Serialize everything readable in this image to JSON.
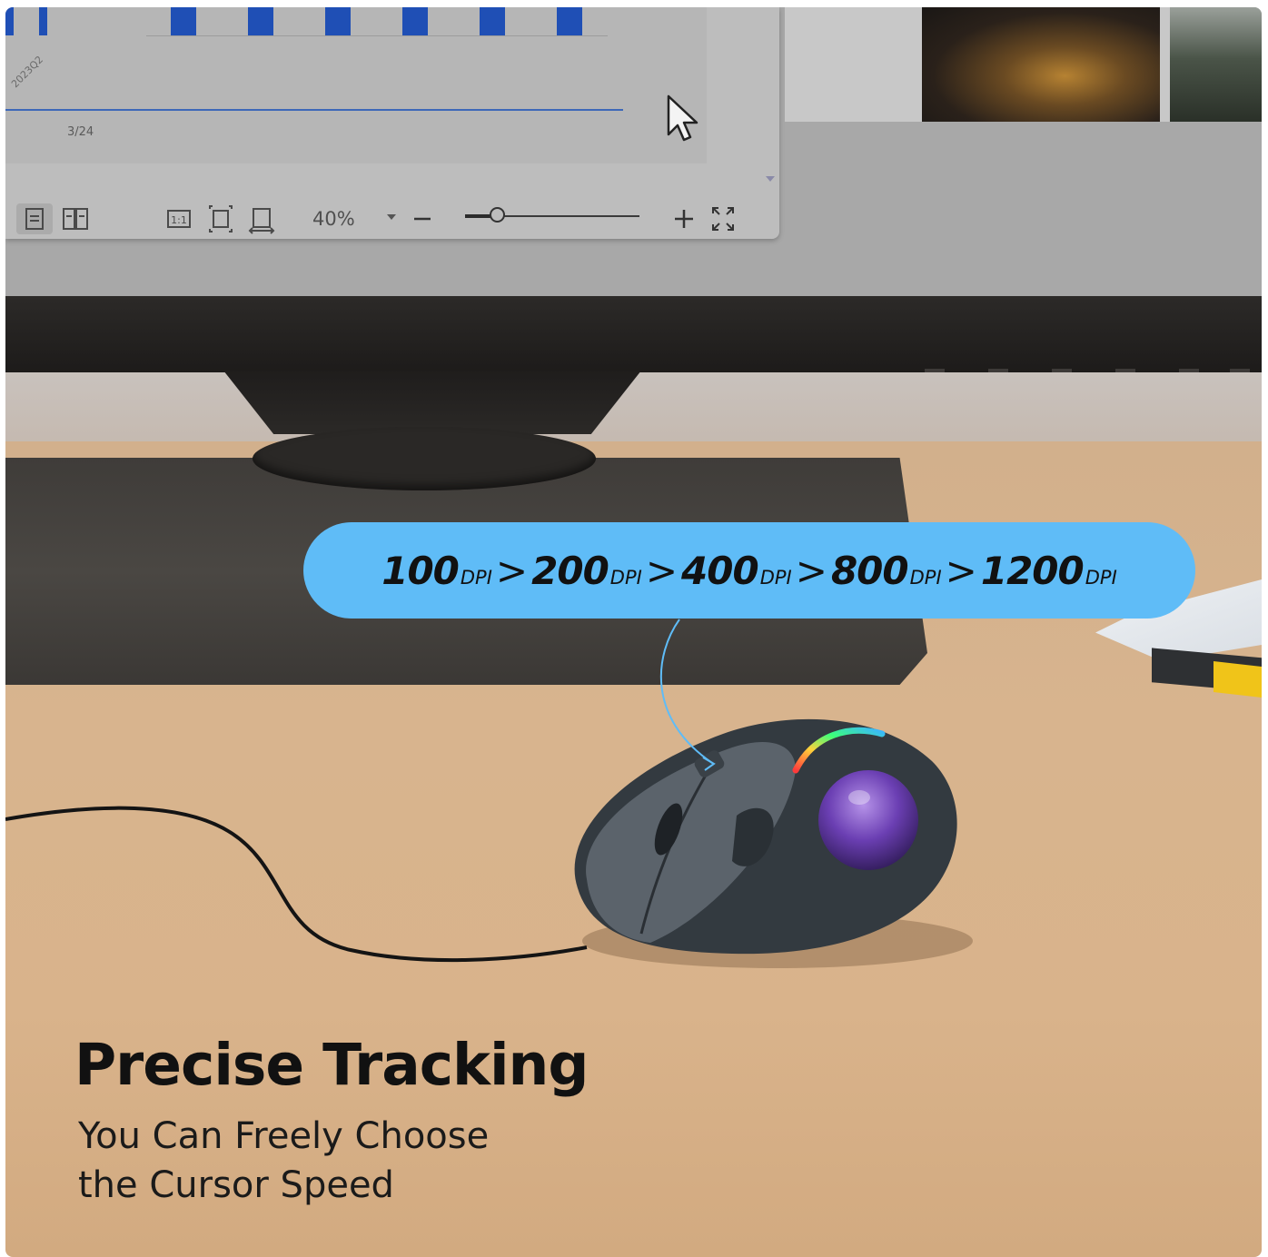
{
  "screen": {
    "bar_tick_labels": [
      "2023Q2"
    ],
    "page_indicator": "3/24",
    "toolbar": {
      "zoom_level": "40%",
      "zoom_slider_fraction": 0.18,
      "icons": [
        "single-page-icon",
        "two-page-icon",
        "actual-size-icon",
        "fit-page-icon",
        "fit-width-icon",
        "zoom-dropdown-icon",
        "zoom-out-icon",
        "zoom-in-icon",
        "fullscreen-icon"
      ]
    }
  },
  "dpi": {
    "unit": "DPI",
    "separator": ">",
    "levels": [
      "100",
      "200",
      "400",
      "800",
      "1200"
    ],
    "pill_color": "#5fbcf7"
  },
  "headline": {
    "title": "Precise Tracking",
    "subtitle_line1": "You Can Freely Choose",
    "subtitle_line2": "the Cursor Speed"
  }
}
